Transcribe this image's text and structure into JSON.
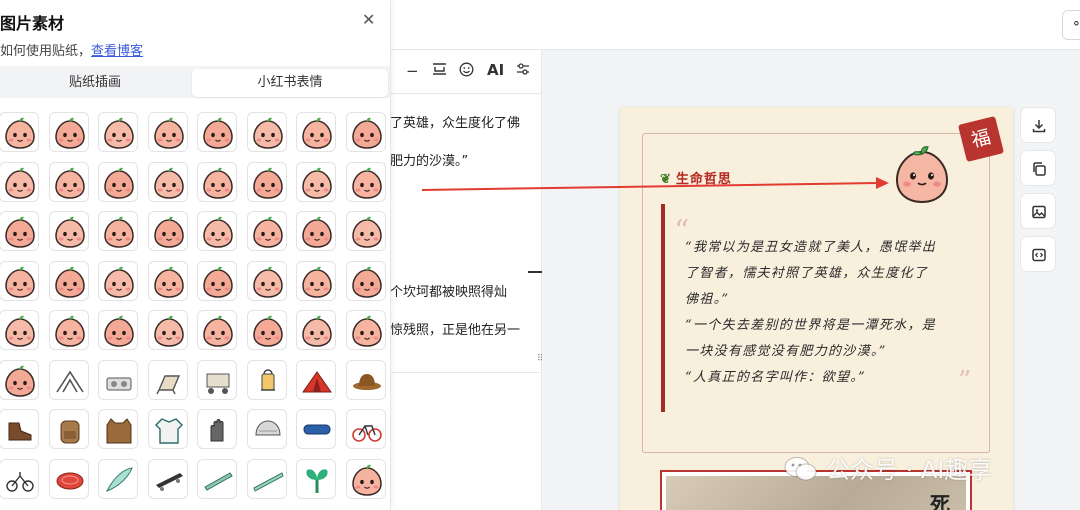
{
  "panel": {
    "title": "图片素材",
    "close_icon": "close-icon",
    "help_text": "如何使用贴纸，",
    "help_link": "查看博客",
    "tabs": [
      {
        "label": "贴纸插画",
        "active": false
      },
      {
        "label": "小红书表情",
        "active": true
      }
    ],
    "stickers": [
      {
        "icon": "face-laugh-icon"
      },
      {
        "icon": "face-pray-icon"
      },
      {
        "icon": "face-facepalm-icon"
      },
      {
        "icon": "face-sweat-icon"
      },
      {
        "icon": "face-shout-icon"
      },
      {
        "icon": "face-drink-icon"
      },
      {
        "icon": "face-phone-icon"
      },
      {
        "icon": "face-hands-icon"
      },
      {
        "icon": "face-kiss-icon"
      },
      {
        "icon": "face-stone-icon"
      },
      {
        "icon": "face-cry-icon"
      },
      {
        "icon": "face-shock-icon"
      },
      {
        "icon": "face-sign-squat-icon"
      },
      {
        "icon": "face-peek-icon"
      },
      {
        "icon": "face-sign-buy-icon"
      },
      {
        "icon": "face-angry-icon"
      },
      {
        "icon": "face-heart-eyes-icon"
      },
      {
        "icon": "face-rage-icon"
      },
      {
        "icon": "face-tears-icon"
      },
      {
        "icon": "face-cover-mouth-icon"
      },
      {
        "icon": "face-point-icon"
      },
      {
        "icon": "face-sad-icon"
      },
      {
        "icon": "face-cover-icon"
      },
      {
        "icon": "face-clap-icon"
      },
      {
        "icon": "face-scream-icon"
      },
      {
        "icon": "face-weep-icon"
      },
      {
        "icon": "face-dizzy-icon"
      },
      {
        "icon": "face-peace-icon"
      },
      {
        "icon": "face-wow-icon"
      },
      {
        "icon": "face-gasp-icon"
      },
      {
        "icon": "face-whisper-icon"
      },
      {
        "icon": "face-gloom-icon"
      },
      {
        "icon": "face-sleepy-icon"
      },
      {
        "icon": "face-sunglasses-icon"
      },
      {
        "icon": "face-eat-icon"
      },
      {
        "icon": "face-hide-icon"
      },
      {
        "icon": "face-bronze-icon"
      },
      {
        "icon": "face-gold-icon"
      },
      {
        "icon": "face-hug-icon"
      },
      {
        "icon": "face-smirk-icon"
      },
      {
        "icon": "face-yellow-icon"
      },
      {
        "icon": "tent-frame-icon"
      },
      {
        "icon": "stove-icon"
      },
      {
        "icon": "camp-chair-icon"
      },
      {
        "icon": "camp-cart-icon"
      },
      {
        "icon": "lantern-icon"
      },
      {
        "icon": "tent-icon"
      },
      {
        "icon": "hat-icon"
      },
      {
        "icon": "hiking-boot-icon"
      },
      {
        "icon": "backpack-icon"
      },
      {
        "icon": "vest-icon"
      },
      {
        "icon": "jersey-icon"
      },
      {
        "icon": "gloves-icon"
      },
      {
        "icon": "helmet-icon"
      },
      {
        "icon": "goggles-icon"
      },
      {
        "icon": "bicycle-icon"
      },
      {
        "icon": "folding-bike-icon"
      },
      {
        "icon": "frisbee-icon"
      },
      {
        "icon": "surfboard-icon"
      },
      {
        "icon": "skateboard-icon"
      },
      {
        "icon": "longboard-icon"
      },
      {
        "icon": "paddleboard-icon"
      },
      {
        "icon": "tree-plant-icon"
      },
      {
        "icon": "face-heart-icon"
      }
    ]
  },
  "editor": {
    "toolbar_ai_label": "AI",
    "toolbar_icons": [
      "minus-icon",
      "line-break-icon",
      "emoji-icon",
      "ai-icon",
      "settings-icon"
    ],
    "lines": [
      {
        "text": "了英雄，众生度化了佛",
        "y": 0
      },
      {
        "text": "肥力的沙漠。”",
        "y": 1
      },
      {
        "text": "个坎坷都被映照得灿",
        "y": 2
      },
      {
        "text": "惊残照，正是他在另一",
        "y": 3
      }
    ]
  },
  "preview": {
    "badge": "福",
    "section_title": "生命哲思",
    "quote_open": "“",
    "quote_close": "”",
    "quote_lines": [
      "“我常以为是丑女造就了美人，愚氓举出",
      "了智者，懦夫衬照了英雄，众生度化了",
      "佛祖。”",
      "“一个失去差别的世界将是一潭死水，是",
      "一块没有感觉没有肥力的沙漠。”",
      "“人真正的名字叫作：欲望。”"
    ],
    "bottom_char": "死"
  },
  "right_tools": [
    "download-icon",
    "copy-icon",
    "image-icon",
    "code-icon"
  ],
  "watermark": "公众号 · AI趣享",
  "top_icon": "share-icon",
  "colors": {
    "accent_red": "#b4261f",
    "link_blue": "#3b5bdb",
    "card_bg": "#f8efdd",
    "arrow_red": "#e23b32"
  }
}
